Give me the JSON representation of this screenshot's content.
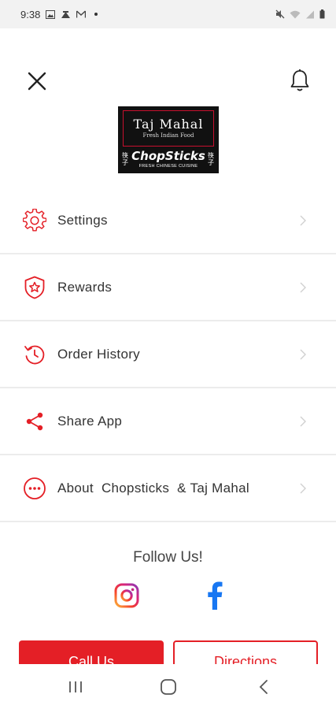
{
  "status_bar": {
    "time": "9:38"
  },
  "header": {
    "close_icon": "close-icon",
    "bell_icon": "bell-icon"
  },
  "logo": {
    "line1": "Taj Mahal",
    "line2": "Fresh Indian Food",
    "line3": "ChopSticks",
    "line4": "FRESH CHINESE CUISINE",
    "side_glyph": "筷子"
  },
  "menu": {
    "items": [
      {
        "label": "Settings",
        "icon": "gear-icon"
      },
      {
        "label": "Rewards",
        "icon": "shield-star-icon"
      },
      {
        "label": "Order History",
        "icon": "history-icon"
      },
      {
        "label": "Share App",
        "icon": "share-icon"
      },
      {
        "label": "About  Chopsticks  & Taj Mahal",
        "icon": "more-circle-icon"
      }
    ]
  },
  "follow": {
    "title": "Follow Us!",
    "instagram_icon": "instagram-icon",
    "facebook_icon": "facebook-icon"
  },
  "actions": {
    "call_label": "Call Us",
    "directions_label": "Directions"
  },
  "colors": {
    "accent": "#e41f26",
    "facebook": "#1877f2"
  }
}
